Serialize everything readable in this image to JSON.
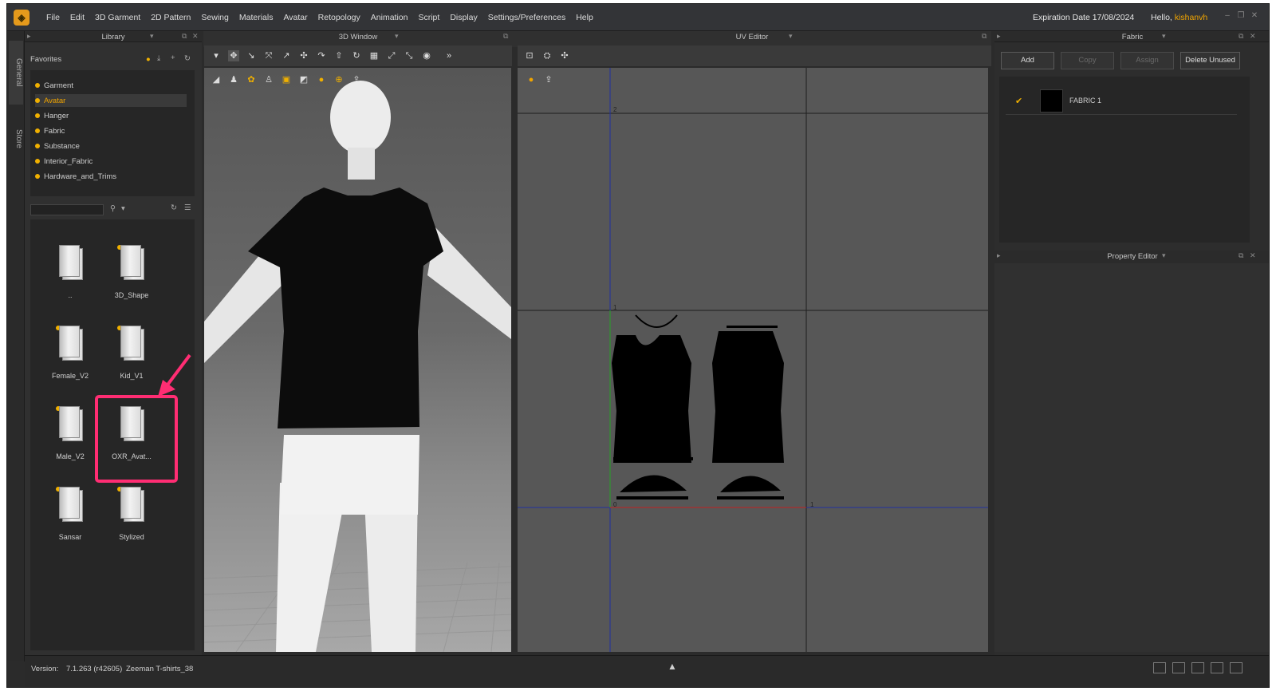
{
  "menubar": {
    "items": [
      "File",
      "Edit",
      "3D Garment",
      "2D Pattern",
      "Sewing",
      "Materials",
      "Avatar",
      "Retopology",
      "Animation",
      "Script",
      "Display",
      "Settings/Preferences",
      "Help"
    ],
    "expiration": "Expiration Date 17/08/2024",
    "hello": "Hello,",
    "username": "kishanvh"
  },
  "sidetabs": {
    "general": "General",
    "store": "Store"
  },
  "library": {
    "title": "Library",
    "favorites_label": "Favorites",
    "favorites": [
      "Garment",
      "Avatar",
      "Hanger",
      "Fabric",
      "Substance",
      "Interior_Fabric",
      "Hardware_and_Trims"
    ],
    "selected_favorite": "Avatar",
    "folders": [
      "..",
      "3D_Shape",
      "Female_V2",
      "Kid_V1",
      "Male_V2",
      "OXR_Avat...",
      "Sansar",
      "Stylized"
    ]
  },
  "view3d": {
    "title": "3D Window"
  },
  "uveditor": {
    "title": "UV Editor",
    "axis_labels": [
      "2",
      "1",
      "0",
      "1"
    ]
  },
  "fabric": {
    "title": "Fabric",
    "buttons": [
      "Add",
      "Copy",
      "Assign",
      "Delete Unused"
    ],
    "items": [
      {
        "name": "FABRIC 1",
        "color": "#000000"
      }
    ]
  },
  "property_editor": {
    "title": "Property Editor"
  },
  "status": {
    "version_label": "Version:",
    "version": "7.1.263 (r42605)",
    "project": "Zeeman T-shirts_38"
  },
  "colors": {
    "accent": "#f0a400",
    "highlight": "#ff2d73"
  }
}
